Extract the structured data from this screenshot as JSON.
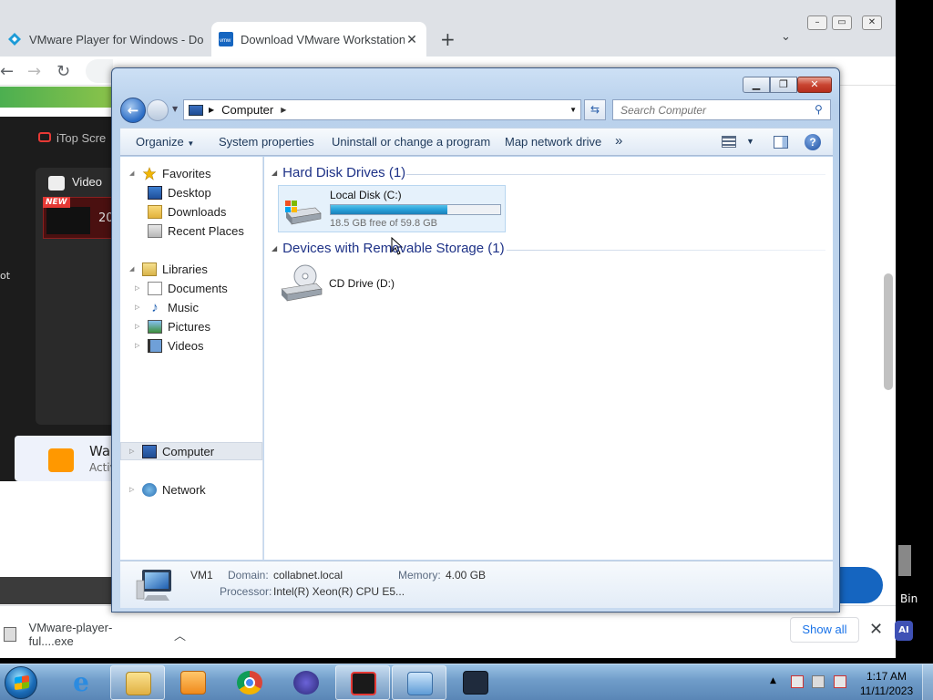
{
  "browser": {
    "tabs": [
      {
        "title": "VMware Player for Windows - Do"
      },
      {
        "title": "Download VMware Workstation"
      }
    ],
    "new_tab": "+",
    "page": {
      "itop_label": "iTop Scre",
      "video_label": "Video",
      "new_badge": "NEW",
      "thumb_text": "20",
      "side_text": "ot",
      "wait_title": "Wa",
      "wait_sub": "Activ"
    },
    "download": {
      "filename": "VMware-player-ful....exe",
      "show_all": "Show all"
    }
  },
  "desktop": {
    "recycle_label": "Bin",
    "ai_label": "AI"
  },
  "explorer": {
    "breadcrumb": "Computer",
    "search_placeholder": "Search Computer",
    "commands": {
      "organize": "Organize",
      "system_properties": "System properties",
      "uninstall": "Uninstall or change a program",
      "map_drive": "Map network drive",
      "more": "»"
    },
    "nav": {
      "favorites": "Favorites",
      "desktop": "Desktop",
      "downloads": "Downloads",
      "recent": "Recent Places",
      "libraries": "Libraries",
      "documents": "Documents",
      "music": "Music",
      "pictures": "Pictures",
      "videos": "Videos",
      "computer": "Computer",
      "network": "Network"
    },
    "groups": {
      "hdd": "Hard Disk Drives (1)",
      "removable": "Devices with Removable Storage (1)"
    },
    "drives": {
      "c_name": "Local Disk (C:)",
      "c_free": "18.5 GB free of 59.8 GB",
      "c_used_fraction": 0.69,
      "d_name": "CD Drive (D:)"
    },
    "details": {
      "name": "VM1",
      "domain_label": "Domain:",
      "domain": "collabnet.local",
      "memory_label": "Memory:",
      "memory": "4.00 GB",
      "processor_label": "Processor:",
      "processor": "Intel(R) Xeon(R) CPU E5..."
    }
  },
  "taskbar": {
    "time": "1:17 AM",
    "date": "11/11/2023"
  }
}
